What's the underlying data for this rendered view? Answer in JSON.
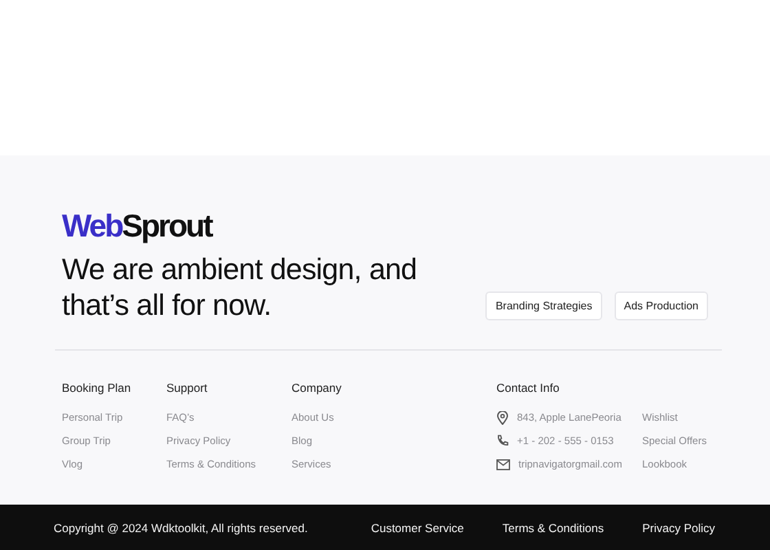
{
  "brand": {
    "logo_first": "Web",
    "logo_second": "Sprout"
  },
  "headline": "We are ambient design, and that’s all for now.",
  "tags": [
    "Branding Strategies",
    "Ads Production"
  ],
  "columns": [
    {
      "title": "Booking Plan",
      "links": [
        "Personal Trip",
        "Group Trip",
        "Vlog"
      ]
    },
    {
      "title": "Support",
      "links": [
        "FAQ’s",
        "Privacy Policy",
        "Terms & Conditions"
      ]
    },
    {
      "title": "Company",
      "links": [
        "About Us",
        "Blog",
        "Services"
      ]
    }
  ],
  "contact": {
    "title": "Contact Info",
    "items": [
      {
        "kind": "location",
        "text": "843, Apple LanePeoria"
      },
      {
        "kind": "phone",
        "text": "+1 - 202 - 555 - 0153"
      },
      {
        "kind": "email",
        "text": "tripnavigatorgmail.com"
      }
    ],
    "links": [
      "Wishlist",
      "Special Offers",
      "Lookbook"
    ]
  },
  "bottom_bar": {
    "copyright": "Copyright @ 2024 Wdktoolkit, All rights reserved.",
    "links": [
      "Customer Service",
      "Terms & Conditions",
      "Privacy Policy"
    ]
  }
}
